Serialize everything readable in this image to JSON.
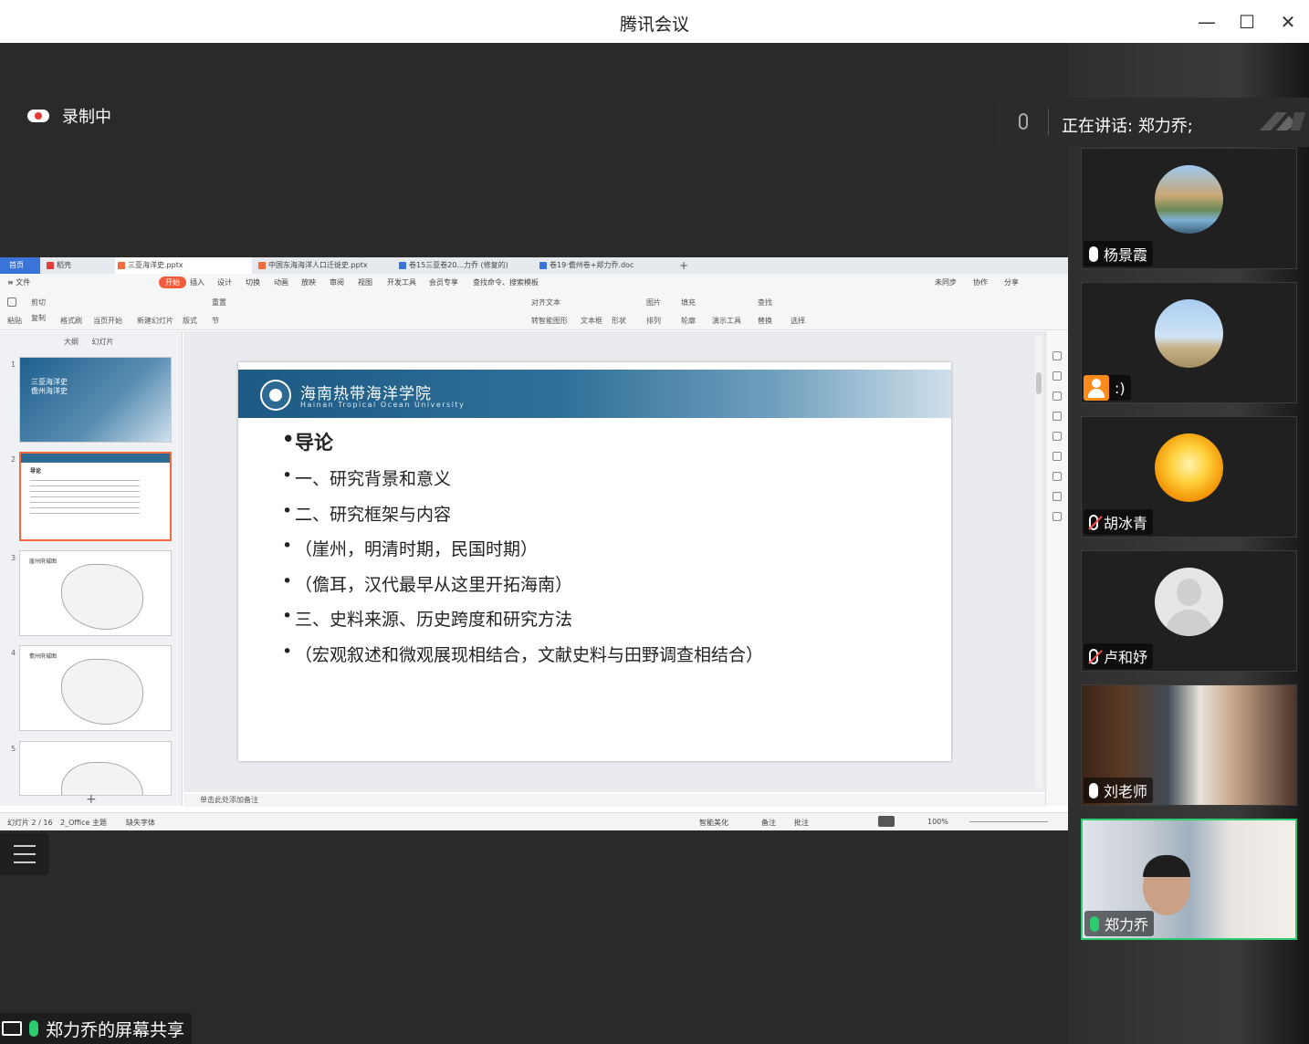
{
  "window": {
    "title": "腾讯会议",
    "min_glyph": "—",
    "max_glyph": "☐",
    "close_glyph": "✕"
  },
  "recording": {
    "label": "录制中"
  },
  "speaking": {
    "label": "正在讲话: 郑力乔;"
  },
  "screen_share": {
    "label": "郑力乔的屏幕共享"
  },
  "participants": [
    {
      "name": "杨景霞",
      "mic": "on"
    },
    {
      "name": ":)",
      "mic": "none"
    },
    {
      "name": "胡冰青",
      "mic": "muted"
    },
    {
      "name": "卢和妤",
      "mic": "muted"
    },
    {
      "name": "刘老师",
      "mic": "on"
    },
    {
      "name": "郑力乔",
      "mic": "active"
    }
  ],
  "wps": {
    "tabs": {
      "home": "首页",
      "jike": "稻壳",
      "doc1": "三亚海洋史.pptx",
      "doc2": "中国东海海洋人口迁徙史.pptx",
      "doc3": "卷15三亚卷20...力乔 (修复的)",
      "doc4": "卷19·儋州卷+郑力乔.doc",
      "plus": "+"
    },
    "menus": {
      "file": "≡ 文件",
      "start": "开始",
      "insert": "插入",
      "design": "设计",
      "switch": "切换",
      "anim": "动画",
      "show": "放映",
      "review": "审阅",
      "view": "视图",
      "devtools": "开发工具",
      "member": "会员专享",
      "search": "查找命令、搜索模板",
      "sync": "未同步",
      "collab": "协作",
      "share": "分享"
    },
    "ribbon": {
      "paste": "粘贴",
      "cut": "剪切",
      "copy": "复制",
      "format_painter": "格式刷",
      "from_current": "当页开始",
      "new_slide": "新建幻灯片",
      "layout": "版式",
      "section": "节",
      "reset": "重置",
      "textbox": "文本框",
      "shape": "形状",
      "arrange": "排列",
      "picture": "图片",
      "fill": "填充",
      "outline": "轮廓",
      "present_tools": "演示工具",
      "find": "查找",
      "replace": "替换",
      "select": "选择",
      "align_text": "对齐文本",
      "to_smartart": "转智能图形"
    },
    "left_tabs": {
      "outline": "大纲",
      "slides": "幻灯片"
    },
    "thumbs": [
      {
        "num": "1",
        "title": "三亚海洋史\n儋州海洋史"
      },
      {
        "num": "2",
        "title": "导论"
      },
      {
        "num": "3",
        "title": "崖州府城图"
      },
      {
        "num": "4",
        "title": "儋州府城图"
      },
      {
        "num": "5",
        "title": ""
      }
    ],
    "slide": {
      "school_cn": "海南热带海洋学院",
      "school_en": "Hainan Tropical Ocean University",
      "bullets": [
        "导论",
        "一、研究背景和意义",
        "二、研究框架与内容",
        "（崖州，明清时期，民国时期）",
        "（儋耳，汉代最早从这里开拓海南）",
        "三、史料来源、历史跨度和研究方法",
        "（宏观叙述和微观展现相结合，文献史料与田野调查相结合）"
      ]
    },
    "notes_placeholder": "单击此处添加备注",
    "status": {
      "slide_pos": "幻灯片 2 / 16",
      "theme": "2_Office 主题",
      "missing_font": "缺失字体",
      "beautify": "智能美化",
      "notes": "备注",
      "comments": "批注",
      "zoom": "100%"
    }
  }
}
